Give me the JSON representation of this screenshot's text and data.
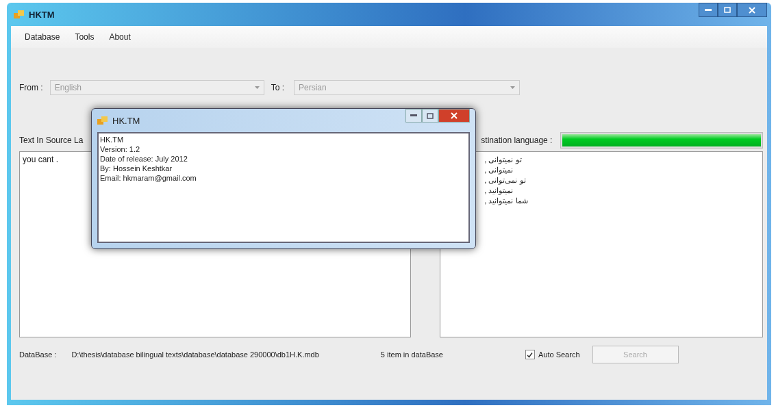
{
  "window": {
    "title": "HKTM"
  },
  "menu": [
    "Database",
    "Tools",
    "About"
  ],
  "from": {
    "label": "From :",
    "value": "English"
  },
  "to": {
    "label": "To :",
    "value": "Persian"
  },
  "source_label": "Text In Source La",
  "dest_label": "stination language :",
  "progress": {
    "level": 1
  },
  "source_text": "you cant .",
  "results": [
    "تو نمیتوانی ,",
    "نمیتوانی ,",
    "تو نمی‌توانی ,",
    "نمیتوانید ,",
    "شما نمیتوانید ,"
  ],
  "database": {
    "label": "DataBase :",
    "path": "D:\\thesis\\database  bilingual texts\\database\\database 290000\\db1H.K.mdb"
  },
  "count": "5  item in dataBase",
  "auto_search": {
    "label": "Auto Search",
    "checked": true
  },
  "search_button": {
    "label": "Search",
    "disabled": true
  },
  "dialog": {
    "title": "HK.TM",
    "lines": [
      "HK.TM",
      "Version: 1.2",
      "Date of release: July 2012",
      "By:  Hossein Keshtkar",
      "Email: hkmaram@gmail.com"
    ]
  }
}
